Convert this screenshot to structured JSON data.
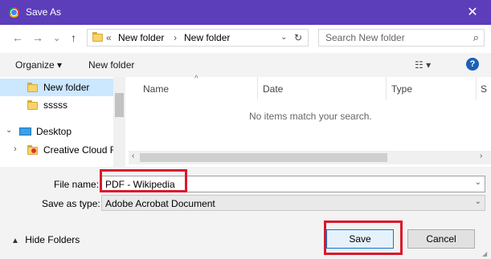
{
  "window": {
    "title": "Save As",
    "close_glyph": "✕"
  },
  "nav": {
    "back": "←",
    "forward": "→",
    "recent": "⌄",
    "up": "↑"
  },
  "address": {
    "prefix": "«",
    "crumbs": [
      "New folder",
      "New folder"
    ],
    "separator": "›",
    "dropdown": "⌄",
    "refresh": "↻"
  },
  "search": {
    "placeholder": "Search New folder",
    "icon": "⌕"
  },
  "toolbar": {
    "organize": "Organize ▾",
    "new_folder": "New folder",
    "view": "☷ ▾",
    "help": "?"
  },
  "tree": [
    {
      "label": "New folder",
      "icon": "folder-icon",
      "selected": true
    },
    {
      "label": "sssss",
      "icon": "folder-icon",
      "selected": false
    },
    {
      "label": "Desktop",
      "icon": "desktop-icon",
      "selected": false
    },
    {
      "label": "Creative Cloud F",
      "icon": "creative-cloud-icon",
      "selected": false
    }
  ],
  "columns": [
    "Name",
    "Date",
    "Type",
    "S"
  ],
  "empty_message": "No items match your search.",
  "form": {
    "filename_label": "File name:",
    "filename_value": "PDF - Wikipedia",
    "savetype_label": "Save as type:",
    "savetype_value": "Adobe Acrobat Document"
  },
  "footer": {
    "hide_folders": "Hide Folders",
    "save": "Save",
    "cancel": "Cancel"
  },
  "colors": {
    "titlebar": "#5c3dba",
    "highlight": "#d9192b",
    "selection": "#cce8ff"
  }
}
